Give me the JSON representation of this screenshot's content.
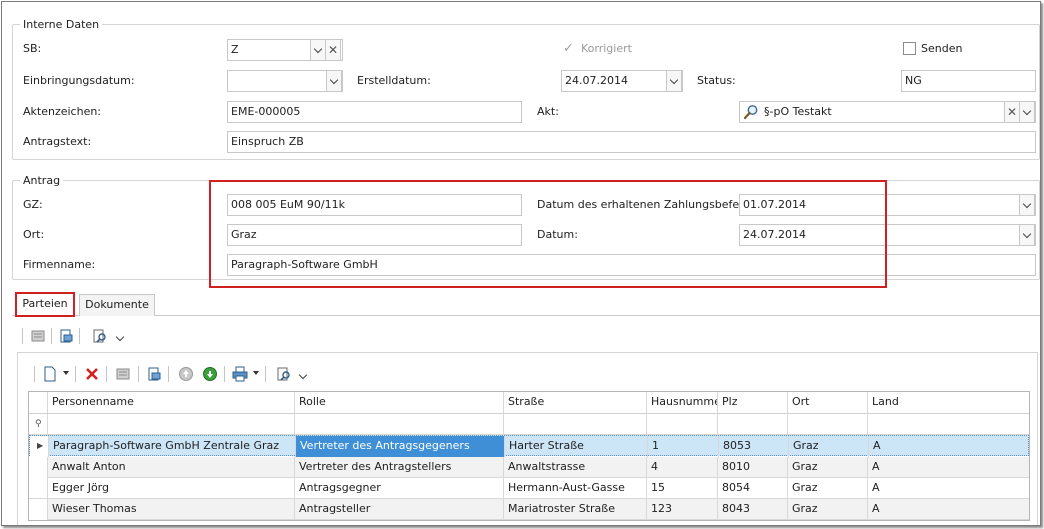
{
  "interne_daten": {
    "legend": "Interne Daten",
    "sb_label": "SB:",
    "sb_value": "Z",
    "korrigiert_label": "Korrigiert",
    "senden_label": "Senden",
    "einbringungsdatum_label": "Einbringungsdatum:",
    "einbringungsdatum_value": "",
    "erstelldatum_label": "Erstelldatum:",
    "erstelldatum_value": "24.07.2014",
    "status_label": "Status:",
    "status_value": "NG",
    "aktenzeichen_label": "Aktenzeichen:",
    "aktenzeichen_value": "EME-000005",
    "akt_label": "Akt:",
    "akt_value": "§-pO Testakt",
    "antragstext_label": "Antragstext:",
    "antragstext_value": "Einspruch ZB"
  },
  "antrag": {
    "legend": "Antrag",
    "gz_label": "GZ:",
    "gz_value": "008 005 EuM 90/11k",
    "datum_zahlungsbefehl_label": "Datum des erhaltenen Zahlungsbefehls:",
    "datum_zahlungsbefehl_value": "01.07.2014",
    "ort_label": "Ort:",
    "ort_value": "Graz",
    "datum_label": "Datum:",
    "datum_value": "24.07.2014",
    "firmenname_label": "Firmenname:",
    "firmenname_value": "Paragraph-Software GmbH"
  },
  "tabs": [
    {
      "label": "Parteien",
      "active": true
    },
    {
      "label": "Dokumente",
      "active": false
    }
  ],
  "grid": {
    "columns": [
      "Personenname",
      "Rolle",
      "Straße",
      "Hausnummer",
      "Plz",
      "Ort",
      "Land"
    ],
    "rows": [
      [
        "Paragraph-Software GmbH Zentrale Graz",
        "Vertreter des Antragsgegeners",
        "Harter Straße",
        "1",
        "8053",
        "Graz",
        "A"
      ],
      [
        "Anwalt Anton",
        "Vertreter des Antragstellers",
        "Anwaltstrasse",
        "4",
        "8010",
        "Graz",
        "A"
      ],
      [
        "Egger Jörg",
        "Antragsgegner",
        "Hermann-Aust-Gasse",
        "15",
        "8054",
        "Graz",
        "A"
      ],
      [
        "Wieser Thomas",
        "Antragsteller",
        "Mariatroster Straße",
        "123",
        "8043",
        "Graz",
        "A"
      ]
    ],
    "selected_row": 0
  },
  "colors": {
    "highlight_box": "#d02020",
    "selected_row_bg": "#cde6f7",
    "selected_cell_bg": "#3f8fd6"
  }
}
